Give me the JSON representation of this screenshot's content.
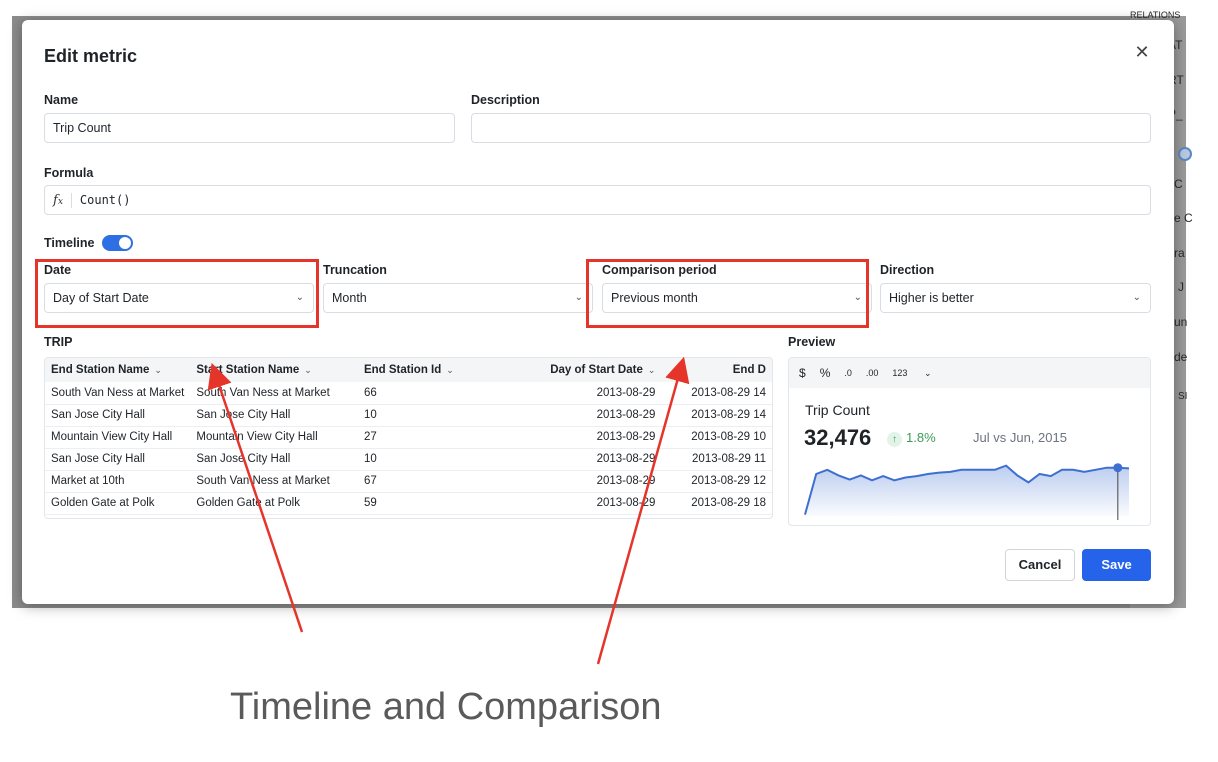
{
  "background": {
    "fragments": [
      "RELATIONS",
      "AT",
      "RT",
      "P_",
      "C",
      "e C",
      "ra",
      "J",
      "un",
      "de",
      "SI"
    ]
  },
  "modal": {
    "title": "Edit metric",
    "close_icon": "close-icon",
    "name_label": "Name",
    "name_value": "Trip Count",
    "description_label": "Description",
    "description_value": "",
    "formula_label": "Formula",
    "formula_icon": "fx-icon",
    "formula_value": "Count()",
    "timeline_label": "Timeline",
    "timeline_enabled": true,
    "date_label": "Date",
    "date_value": "Day of Start Date",
    "truncation_label": "Truncation",
    "truncation_value": "Month",
    "comparison_label": "Comparison period",
    "comparison_value": "Previous month",
    "direction_label": "Direction",
    "direction_value": "Higher is better",
    "table_label": "TRIP",
    "preview_label": "Preview",
    "cancel_label": "Cancel",
    "save_label": "Save",
    "accent_color": "#2563eb"
  },
  "table": {
    "columns": [
      "End Station Name",
      "Start Station Name",
      "End Station Id",
      "Day of Start Date",
      "End D"
    ],
    "rows": [
      [
        "South Van Ness at Market",
        "South Van Ness at Market",
        "66",
        "2013-08-29",
        "2013-08-29 14"
      ],
      [
        "San Jose City Hall",
        "San Jose City Hall",
        "10",
        "2013-08-29",
        "2013-08-29 14"
      ],
      [
        "Mountain View City Hall",
        "Mountain View City Hall",
        "27",
        "2013-08-29",
        "2013-08-29 10"
      ],
      [
        "San Jose City Hall",
        "San Jose City Hall",
        "10",
        "2013-08-29",
        "2013-08-29 11"
      ],
      [
        "Market at 10th",
        "South Van Ness at Market",
        "67",
        "2013-08-29",
        "2013-08-29 12"
      ],
      [
        "Golden Gate at Polk",
        "Golden Gate at Polk",
        "59",
        "2013-08-29",
        "2013-08-29 18"
      ]
    ]
  },
  "preview": {
    "format_buttons": [
      "$",
      "%",
      ".0",
      ".00",
      "123"
    ],
    "kpi_title": "Trip Count",
    "kpi_value": "32,476",
    "change_text": "1.8%",
    "compare_text": "Jul vs Jun, 2015",
    "positive_color": "#3a9b57",
    "line_color": "#3d6fd1",
    "sparkline": [
      2,
      60,
      66,
      58,
      52,
      58,
      51,
      57,
      51,
      55,
      57,
      60,
      62,
      63,
      66,
      66,
      66,
      66,
      72,
      58,
      48,
      60,
      57,
      66,
      66,
      63,
      66,
      69,
      69,
      68
    ]
  },
  "annotation": {
    "caption": "Timeline and Comparison",
    "highlight_color": "#e5352b"
  }
}
